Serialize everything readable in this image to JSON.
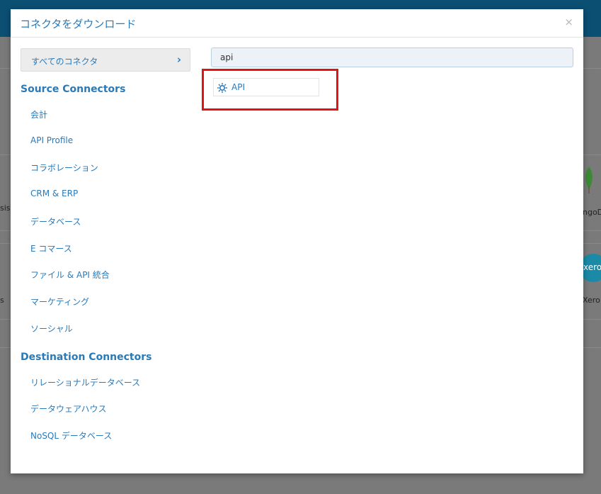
{
  "background": {
    "partial_texts": [
      {
        "id": "sis",
        "text": "sis"
      },
      {
        "id": "ngod",
        "text": "ngoD"
      },
      {
        "id": "s",
        "text": "s"
      },
      {
        "id": "xero",
        "text": "Xero"
      }
    ],
    "xero_logo_text": "xero"
  },
  "modal": {
    "title": "コネクタをダウンロード",
    "close_label": "×",
    "all_connectors_label": "すべてのコネクタ",
    "chevron": "›",
    "source_section_title": "Source Connectors",
    "source_items": [
      "会計",
      "API Profile",
      "コラボレーション",
      "CRM & ERP",
      "データベース",
      "E コマース",
      "ファイル & API 統合",
      "マーケティング",
      "ソーシャル"
    ],
    "destination_section_title": "Destination Connectors",
    "destination_items": [
      "リレーショナルデータベース",
      "データウェアハウス",
      "NoSQL データベース"
    ]
  },
  "search": {
    "value": "api",
    "placeholder": ""
  },
  "results": [
    {
      "label": "API",
      "icon": "api-gear-icon"
    }
  ],
  "colors": {
    "accent": "#2a7ab8",
    "highlight": "#e01414"
  }
}
